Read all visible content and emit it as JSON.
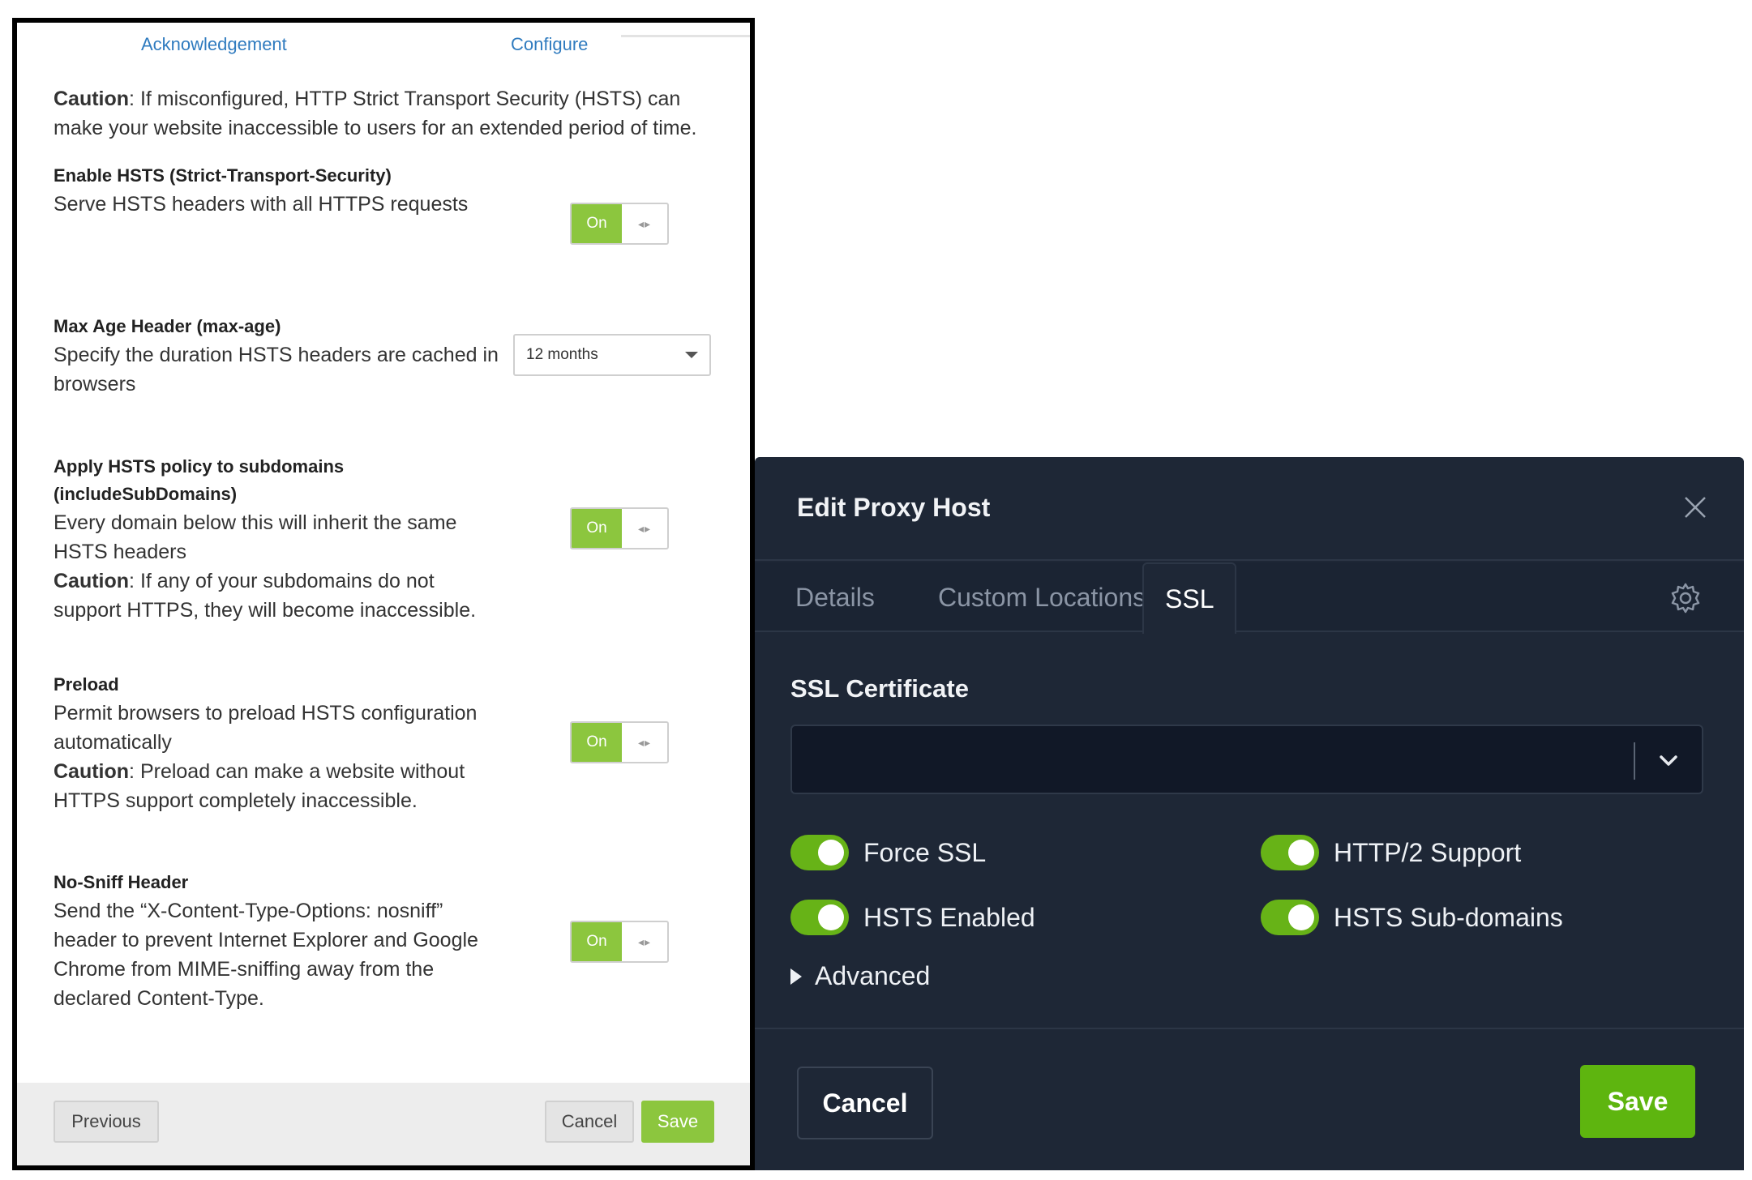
{
  "left": {
    "tabs": [
      "Acknowledgement",
      "Configure"
    ],
    "caution_label": "Caution",
    "caution_text": ": If misconfigured, HTTP Strict Transport Security (HSTS) can make your website inaccessible to users for an extended period of time.",
    "enable_hsts": {
      "title": "Enable HSTS (Strict-Transport-Security)",
      "desc": "Serve HSTS headers with all HTTPS requests",
      "toggle": "On"
    },
    "max_age": {
      "title": "Max Age Header (max-age)",
      "desc": "Specify the duration HSTS headers are cached in browsers",
      "value": "12 months"
    },
    "subdomains": {
      "title": "Apply HSTS policy to subdomains (includeSubDomains)",
      "desc": "Every domain below this will inherit the same HSTS headers",
      "caution_label": "Caution",
      "caution_text": ": If any of your subdomains do not support HTTPS, they will become inaccessible.",
      "toggle": "On"
    },
    "preload": {
      "title": "Preload",
      "desc": "Permit browsers to preload HSTS configuration automatically",
      "caution_label": "Caution",
      "caution_text": ": Preload can make a website without HTTPS support completely inaccessible.",
      "toggle": "On"
    },
    "nosniff": {
      "title": "No-Sniff Header",
      "desc": "Send the “X-Content-Type-Options: nosniff” header to prevent Internet Explorer and Google Chrome from MIME-sniffing away from the declared Content-Type.",
      "toggle": "On"
    },
    "footer": {
      "previous": "Previous",
      "cancel": "Cancel",
      "save": "Save"
    }
  },
  "right": {
    "title": "Edit Proxy Host",
    "tabs": [
      "Details",
      "Custom Locations",
      "SSL"
    ],
    "ssl_certificate_label": "SSL Certificate",
    "ssl_certificate_value": "",
    "switches": {
      "force_ssl": "Force SSL",
      "http2": "HTTP/2 Support",
      "hsts_enabled": "HSTS Enabled",
      "hsts_subdomains": "HSTS Sub-domains"
    },
    "advanced": "Advanced",
    "cancel": "Cancel",
    "save": "Save"
  },
  "colors": {
    "toggle_green": "#8cc63e",
    "npm_green": "#5eb50f",
    "npm_bg": "#1e2736",
    "link_blue": "#2f7bbf"
  },
  "icons": [
    "close-icon",
    "gear-icon",
    "chevron-down-icon",
    "caret-right-icon"
  ]
}
